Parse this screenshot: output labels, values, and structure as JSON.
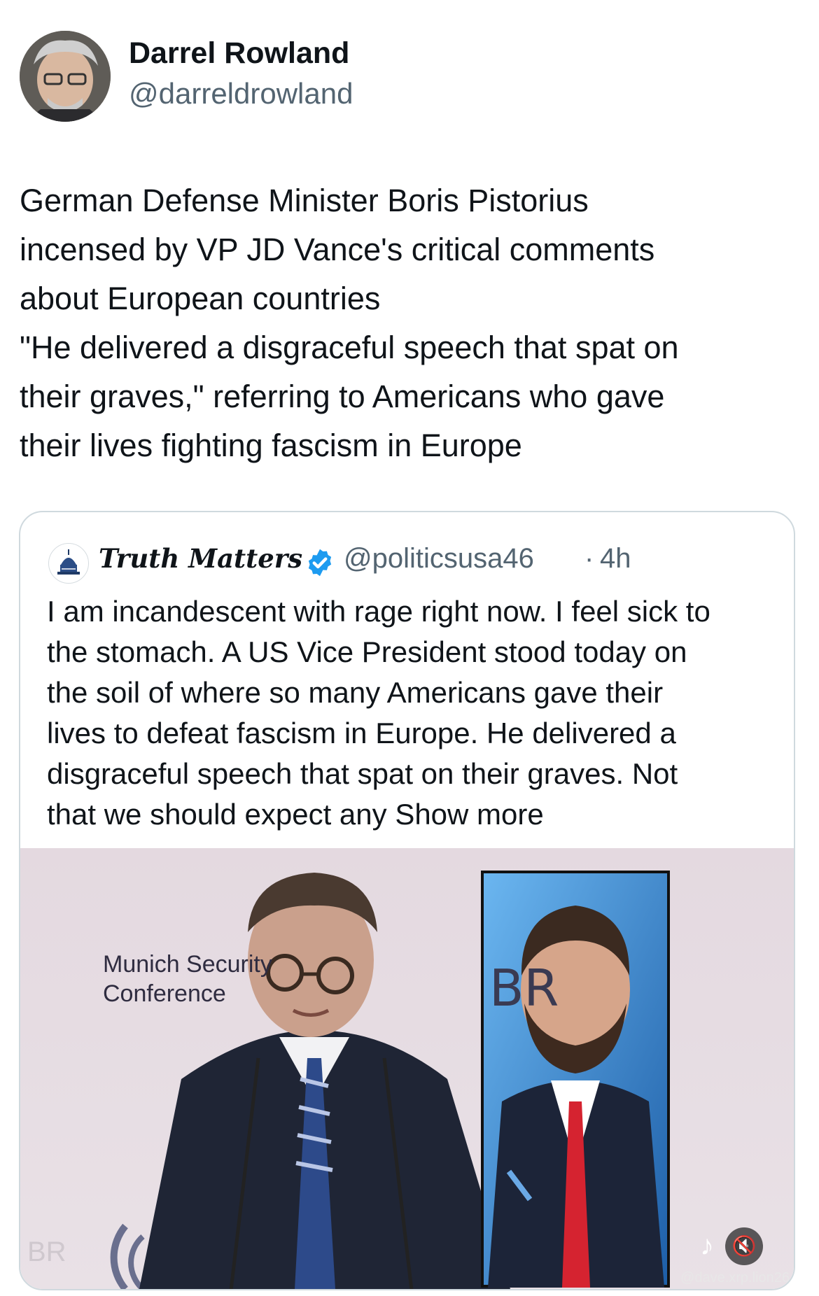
{
  "author": {
    "display_name": "Darrel Rowland",
    "handle": "@darreldrowland",
    "avatar_icon": "user-avatar-icon"
  },
  "tweet": {
    "lines": [
      "German Defense Minister Boris Pistorius",
      "incensed by VP JD Vance's critical comments",
      "about European countries",
      "\"He delivered a disgraceful speech that spat on",
      "their graves,\" referring to Americans who gave",
      "their lives fighting fascism in Europe"
    ]
  },
  "quote": {
    "display_name": "Truth Matters",
    "handle": "@politicsusa46",
    "separator": "·",
    "time": "4h",
    "verified_icon": "verified-badge-icon",
    "lines": [
      "I am incandescent with rage right now. I feel sick to",
      "the stomach. A US Vice President stood today on",
      "the soil of where so many Americans gave their",
      "lives to defeat fascism in Europe. He delivered a",
      "disgraceful speech that spat on their graves. Not",
      "that we should expect any Show more"
    ],
    "media": {
      "backdrop_line1": "Munich Security",
      "backdrop_line2": "Conference",
      "backdrop_logo": "BR",
      "watermark": "@dave.xrp.lion26",
      "mute_icon": "muted-speaker-icon",
      "tiktok_icon": "tiktok-logo-icon"
    }
  },
  "colors": {
    "text_primary": "#0f1419",
    "text_secondary": "#536471",
    "border": "#cfd9de",
    "verified_blue": "#1d9bf0"
  }
}
